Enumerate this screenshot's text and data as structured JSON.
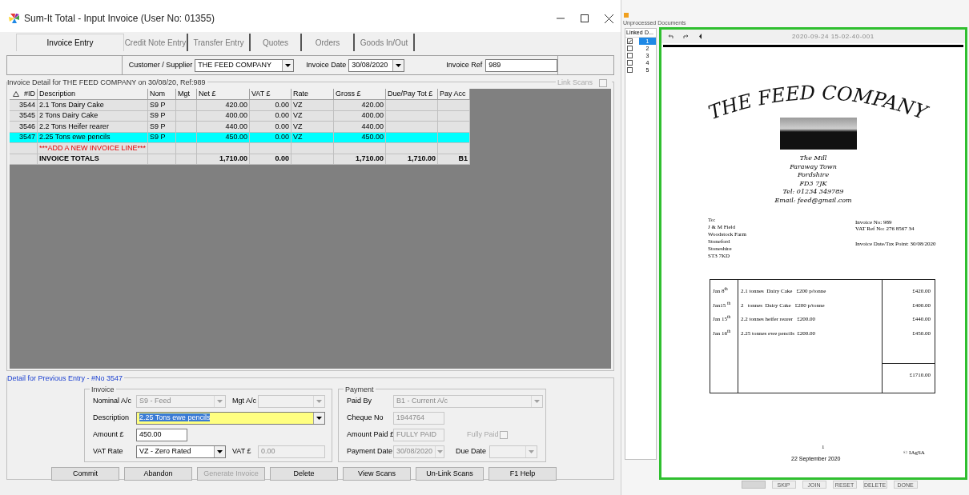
{
  "main_window": {
    "title": "Sum-It Total - Input Invoice (User No: 01355)",
    "tabs": [
      {
        "label": "Invoice Entry",
        "selected": true
      },
      {
        "label": "Credit Note Entry",
        "selected": false
      },
      {
        "label": "Transfer Entry",
        "selected": false
      },
      {
        "label": "Quotes",
        "selected": false
      },
      {
        "label": "Orders",
        "selected": false
      },
      {
        "label": "Goods In/Out",
        "selected": false
      }
    ],
    "header": {
      "customer_label": "Customer / Supplier",
      "customer": "THE FEED COMPANY",
      "date_label": "Invoice Date",
      "date": "30/08/2020",
      "ref_label": "Invoice Ref",
      "ref": "989"
    },
    "detail_group": {
      "title": "Invoice Detail for  THE FEED COMPANY on 30/08/20, Ref:989",
      "link_scans_label": "Link Scans",
      "link_scans_checked": false
    },
    "table": {
      "columns": [
        "#ID",
        "Description",
        "Nom",
        "Mgt",
        "Net £",
        "VAT £",
        "Rate",
        "Gross £",
        "Due/Pay Tot £",
        "Pay Acc"
      ],
      "rows": [
        {
          "kind": "line",
          "selected": false,
          "cells": [
            "3544",
            "2.1 Tons Dairy Cake",
            "S9 P",
            "",
            "420.00",
            "0.00",
            "VZ",
            "420.00",
            "",
            ""
          ]
        },
        {
          "kind": "line",
          "selected": false,
          "cells": [
            "3545",
            "2 Tons Dairy Cake",
            "S9 P",
            "",
            "400.00",
            "0.00",
            "VZ",
            "400.00",
            "",
            ""
          ]
        },
        {
          "kind": "line",
          "selected": false,
          "cells": [
            "3546",
            "2.2 Tons Heifer rearer",
            "S9 P",
            "",
            "440.00",
            "0.00",
            "VZ",
            "440.00",
            "",
            ""
          ]
        },
        {
          "kind": "line",
          "selected": true,
          "cells": [
            "3547",
            "2.25 Tons ewe pencils",
            "S9 P",
            "",
            "450.00",
            "0.00",
            "VZ",
            "450.00",
            "",
            ""
          ]
        },
        {
          "kind": "new",
          "selected": false,
          "cells": [
            "",
            "***ADD A NEW INVOICE LINE***",
            "",
            "",
            "",
            "",
            "",
            "",
            "",
            ""
          ]
        },
        {
          "kind": "totals",
          "selected": false,
          "cells": [
            "",
            "INVOICE TOTALS",
            "",
            "",
            "1,710.00",
            "0.00",
            "",
            "1,710.00",
            "1,710.00",
            "B1"
          ]
        }
      ]
    },
    "previous_entry": {
      "title": "Detail for Previous Entry - #No 3547",
      "invoice": {
        "title": "Invoice",
        "nominal_label": "Nominal A/c",
        "nominal": "S9 - Feed",
        "mgt_label": "Mgt A/c",
        "description_label": "Description",
        "description": "2.25 Tons ewe pencils",
        "amount_label": "Amount £",
        "amount": "450.00",
        "vat_rate_label": "VAT Rate",
        "vat_rate": "VZ - Zero Rated",
        "vat_label": "VAT £",
        "vat": "0.00"
      },
      "payment": {
        "title": "Payment",
        "paid_by_label": "Paid By",
        "paid_by": "B1 - Current A/c",
        "cheque_label": "Cheque No",
        "cheque": "1944764",
        "amount_paid_label": "Amount Paid £",
        "amount_paid": "FULLY PAID",
        "fully_paid_label": "Fully Paid",
        "fully_paid": false,
        "payment_date_label": "Payment Date",
        "payment_date": "30/08/2020",
        "due_date_label": "Due Date"
      }
    },
    "buttons": [
      {
        "label": "Commit",
        "disabled": false
      },
      {
        "label": "Abandon",
        "disabled": false
      },
      {
        "label": "Generate Invoice",
        "disabled": true
      },
      {
        "label": "Delete",
        "disabled": false
      },
      {
        "label": "View Scans",
        "disabled": false
      },
      {
        "label": "Un-Link Scans",
        "disabled": false
      },
      {
        "label": "F1 Help",
        "disabled": false
      }
    ]
  },
  "linker_window": {
    "section_label": "Unprocessed Documents",
    "list": {
      "columns": [
        "Linked",
        "D..."
      ],
      "rows": [
        {
          "linked": true,
          "selected": true,
          "number": "1"
        },
        {
          "linked": false,
          "selected": false,
          "number": "2"
        },
        {
          "linked": false,
          "selected": false,
          "number": "3"
        },
        {
          "linked": false,
          "selected": false,
          "number": "4"
        },
        {
          "linked": false,
          "selected": false,
          "number": "5"
        }
      ]
    },
    "viewer_title": "2020-09-24 15-02-40-001",
    "document": {
      "logo_text": "THE FEED COMPANY",
      "address_lines": [
        "The Mill",
        "Faraway Town",
        "Fordshire",
        "FD3 7JK",
        "Tel: 01234 349789",
        "Email: feed@gmail.com"
      ],
      "to_lines": [
        "To:",
        "J & M Field",
        "Woodstock Farm",
        "Stoneford",
        "Stoneshire",
        "ST3 7KD"
      ],
      "invoice_no": "Invoice No: 989",
      "vat_ref": "VAT Ref No: 276 8567 34",
      "tax_point": "Invoice Date/Tax Point: 30/08/2020",
      "items": [
        {
          "date": "Jan 8$^{th}$",
          "description": "2.1 tonnes  Dairy Cake   £200 p/tonne",
          "amount": "£420.00"
        },
        {
          "date": "Jan15 $^{th}$",
          "description": "2   tonnes  Dairy Cake   £200 p/tonne",
          "amount": "£400.00"
        },
        {
          "date": "Jan 15$^{th}$",
          "description": "2.2 tonnes heifer rearer   £200.00",
          "amount": "£440.00"
        },
        {
          "date": "Jan 16$^{th}$",
          "description": "2.25 tonnes ewe pencils  £200.00",
          "amount": "£450.00"
        }
      ],
      "total": "£1710.00",
      "page_number": "1",
      "footer_date": "22 September 2020",
      "copyright": "© IAgSA"
    },
    "buttons": [
      "SKIP",
      "JOIN",
      "RESET",
      "DELETE",
      "DONE"
    ]
  }
}
